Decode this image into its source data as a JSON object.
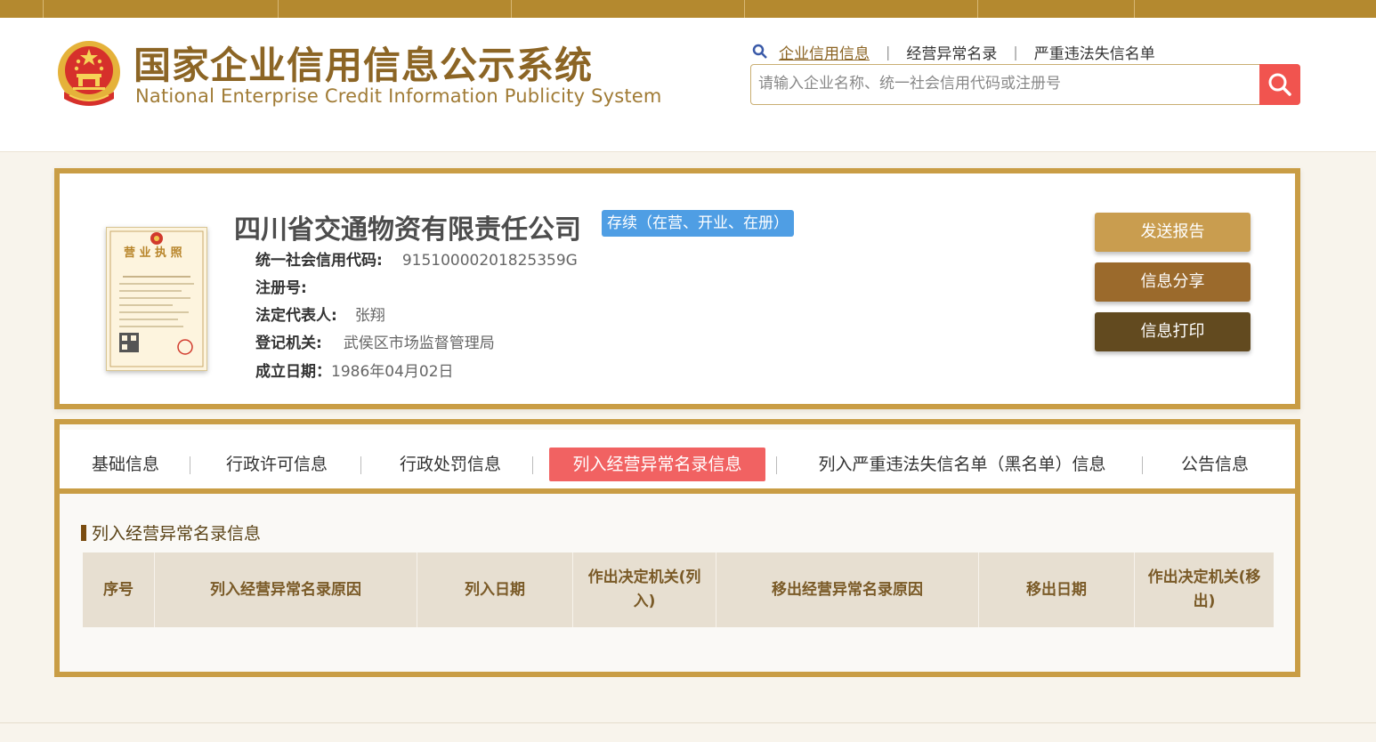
{
  "header": {
    "logo_cn": "国家企业信用信息公示系统",
    "logo_en": "National Enterprise Credit Information Publicity System",
    "nav": [
      "企业信用信息",
      "经营异常名录",
      "严重违法失信名单"
    ],
    "search_placeholder": "请输入企业名称、统一社会信用代码或注册号"
  },
  "company": {
    "name": "四川省交通物资有限责任公司",
    "status": "存续（在营、开业、在册）",
    "credit_code_label": "统一社会信用代码:",
    "credit_code": "91510000201825359G",
    "reg_no_label": "注册号:",
    "reg_no": "",
    "legal_rep_label": "法定代表人:",
    "legal_rep": "张翔",
    "authority_label": "登记机关:",
    "authority": "武侯区市场监督管理局",
    "established_label": "成立日期：",
    "established": "1986年04月02日",
    "license_title": "营 业 执 照"
  },
  "actions": {
    "send": "发送报告",
    "share": "信息分享",
    "print": "信息打印"
  },
  "tabs": [
    "基础信息",
    "行政许可信息",
    "行政处罚信息",
    "列入经营异常名录信息",
    "列入严重违法失信名单（黑名单）信息",
    "公告信息"
  ],
  "active_tab": "列入经营异常名录信息",
  "section": {
    "title": "列入经营异常名录信息",
    "columns": [
      "序号",
      "列入经营异常名录原因",
      "列入日期",
      "作出决定机关(列入)",
      "移出经营异常名录原因",
      "移出日期",
      "作出决定机关(移出)"
    ]
  },
  "colors": {
    "gold": "#c99d45",
    "topbar": "#b4892f",
    "active_tab": "#f16262",
    "status_badge": "#4f9ee4",
    "search_button": "#f1544f"
  }
}
